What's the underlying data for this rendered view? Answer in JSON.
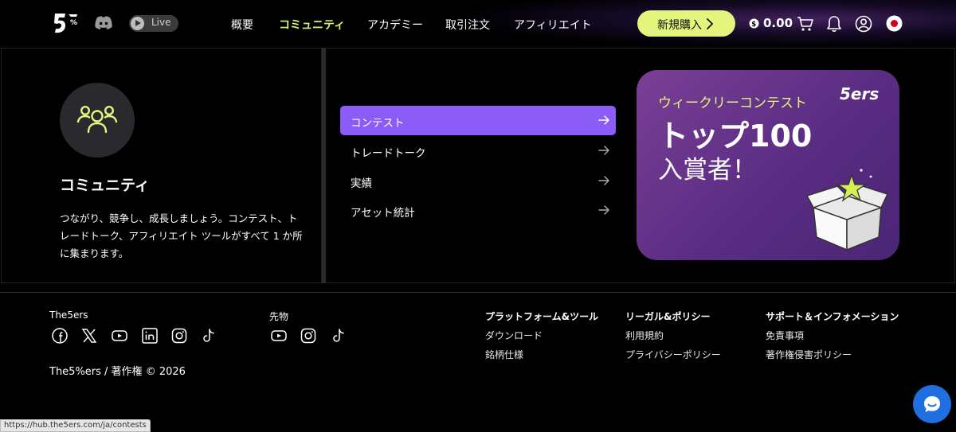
{
  "header": {
    "live_label": "Live",
    "nav": [
      {
        "label": "概要",
        "active": false
      },
      {
        "label": "コミュニティ",
        "active": true
      },
      {
        "label": "アカデミー",
        "active": false
      },
      {
        "label": "取引注文",
        "active": false
      },
      {
        "label": "アフィリエイト",
        "active": false
      }
    ],
    "buy_label": "新規購入",
    "balance": "0.00",
    "accent_color": "#d8f26a",
    "icons": [
      "logo",
      "discord-icon",
      "play-icon",
      "coin-icon",
      "cart-icon",
      "bell-icon",
      "user-icon",
      "japan-flag-icon"
    ]
  },
  "community": {
    "title": "コミュニティ",
    "description_lines": [
      "つながり、競争し、成長しましょう。コンテスト、ト",
      "レードトーク、アフィリエイト ツールがすべて 1 か所",
      "に集まります。"
    ],
    "icon": "community-users-icon"
  },
  "menu": {
    "items": [
      {
        "label": "コンテスト",
        "active": true
      },
      {
        "label": "トレードトーク",
        "active": false
      },
      {
        "label": "実績",
        "active": false
      },
      {
        "label": "アセット統計",
        "active": false
      }
    ],
    "active_color": "#8b5cf6"
  },
  "promo": {
    "subtitle": "ウィークリーコンテスト",
    "line1": "トップ100",
    "line2": "入賞者！",
    "logo_text": "5ers"
  },
  "footer": {
    "brand_heading": "The5ers",
    "futures_heading": "先物",
    "columns": [
      {
        "heading": "プラットフォーム&ツール",
        "links": [
          "ダウンロード",
          "銘柄仕様"
        ]
      },
      {
        "heading": "リーガル&ポリシー",
        "links": [
          "利用規約",
          "プライバシーポリシー"
        ]
      },
      {
        "heading": "サポート＆インフォメーション",
        "links": [
          "免責事項",
          "著作権侵害ポリシー"
        ]
      }
    ],
    "copyright": "The5%ers / 著作権 © 2026",
    "brand_socials": [
      "facebook-icon",
      "x-icon",
      "youtube-icon",
      "linkedin-icon",
      "instagram-icon",
      "tiktok-icon"
    ],
    "futures_socials": [
      "youtube-icon",
      "instagram-icon",
      "tiktok-icon"
    ]
  },
  "status_url": "https://hub.the5ers.com/ja/contests"
}
